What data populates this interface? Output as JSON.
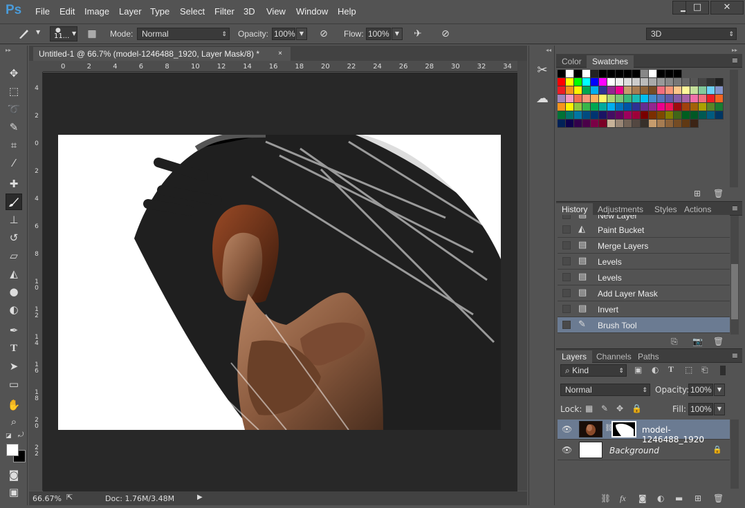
{
  "app": {
    "logo": "Ps",
    "menus": [
      "File",
      "Edit",
      "Image",
      "Layer",
      "Type",
      "Select",
      "Filter",
      "3D",
      "View",
      "Window",
      "Help"
    ],
    "window_buttons": [
      "▁",
      "□",
      "✕"
    ]
  },
  "options": {
    "brush_size": "11...",
    "mode_label": "Mode:",
    "mode_value": "Normal",
    "opacity_label": "Opacity:",
    "opacity_value": "100%",
    "flow_label": "Flow:",
    "flow_value": "100%",
    "workspace": "3D"
  },
  "document": {
    "tab_title": "Untitled-1 @ 66.7% (model-1246488_1920, Layer Mask/8) *",
    "ruler_top": [
      "0",
      "2",
      "4",
      "6",
      "8",
      "10",
      "12",
      "14",
      "16",
      "18",
      "20",
      "22",
      "24",
      "26",
      "28",
      "30",
      "32",
      "34"
    ],
    "ruler_left": [
      "4",
      "2",
      "0",
      "2",
      "4",
      "6",
      "8",
      "1\n0",
      "1\n2",
      "1\n4",
      "1\n6",
      "1\n8",
      "2\n0",
      "2\n2"
    ],
    "zoom": "66.67%",
    "doc_info": "Doc: 1.76M/3.48M"
  },
  "swatches_panel": {
    "tabs": [
      "Color",
      "Swatches"
    ],
    "active_tab": "Swatches",
    "rows": [
      [
        "#000000",
        "#ffffff",
        "#000000",
        "#ffffff",
        "#222222",
        "#000000",
        "#000000",
        "#000000",
        "#000000",
        "#000000",
        "#888888",
        "#ffffff",
        "#000000",
        "#000000",
        "#000000"
      ],
      [
        "#ff0000",
        "#ffff00",
        "#00ff00",
        "#00ffff",
        "#0000ff",
        "#ff00ff",
        "#ffffff",
        "#eeeeee",
        "#dddddd",
        "#cccccc",
        "#bbbbbb",
        "#aaaaaa",
        "#999999",
        "#888888",
        "#777777",
        "#666666",
        "#555555",
        "#444444",
        "#333333",
        "#222222"
      ],
      [
        "#ed1c24",
        "#f7941d",
        "#fff200",
        "#00a651",
        "#00aeef",
        "#2e3192",
        "#92278f",
        "#ec008c",
        "#c69c6d",
        "#a67c52",
        "#8c6239",
        "#754c24",
        "#f26d7d",
        "#f69679",
        "#fdc689",
        "#fff799",
        "#c4df9b",
        "#82ca9c",
        "#6dcff6",
        "#8393ca"
      ],
      [
        "#a186be",
        "#f49ac2",
        "#f26c4f",
        "#f7977a",
        "#fbaf5d",
        "#fff568",
        "#acd373",
        "#7cc576",
        "#3bb878",
        "#1abbb4",
        "#00bff3",
        "#448ccb",
        "#5674b9",
        "#605ca8",
        "#855fa8",
        "#a763a8",
        "#f06ea9",
        "#f26d7d",
        "#ed1c24",
        "#f26522"
      ],
      [
        "#f7941d",
        "#fff200",
        "#8dc63f",
        "#39b54a",
        "#00a651",
        "#00a99d",
        "#00aeef",
        "#0072bc",
        "#0054a6",
        "#2e3192",
        "#662d91",
        "#92278f",
        "#ec008c",
        "#ed145b",
        "#9e0b0f",
        "#a0410d",
        "#a36209",
        "#aba000",
        "#598527",
        "#1a7b30"
      ],
      [
        "#007236",
        "#00746b",
        "#0076a3",
        "#004b80",
        "#003471",
        "#1b1464",
        "#440e62",
        "#630460",
        "#9e005d",
        "#9e0039",
        "#790000",
        "#7b2e00",
        "#7d4900",
        "#827b00",
        "#406618",
        "#005e20",
        "#005826",
        "#005952",
        "#005b7f",
        "#003663"
      ],
      [
        "#002157",
        "#0d004c",
        "#32004b",
        "#4b0049",
        "#7b0046",
        "#7a0026",
        "#c7b299",
        "#998675",
        "#736357",
        "#534741",
        "#37302a",
        "#c69c6d",
        "#a67c52",
        "#8c6239",
        "#754c24",
        "#603913",
        "#3c2415"
      ]
    ]
  },
  "history_panel": {
    "tabs": [
      "History",
      "Adjustments",
      "Styles",
      "Actions"
    ],
    "active_tab": "History",
    "items": [
      {
        "label": "New Layer",
        "icon": "document-icon"
      },
      {
        "label": "Paint Bucket",
        "icon": "paint-bucket-icon"
      },
      {
        "label": "Merge Layers",
        "icon": "document-icon"
      },
      {
        "label": "Levels",
        "icon": "document-icon"
      },
      {
        "label": "Levels",
        "icon": "document-icon"
      },
      {
        "label": "Add Layer Mask",
        "icon": "document-icon"
      },
      {
        "label": "Invert",
        "icon": "document-icon"
      },
      {
        "label": "Brush Tool",
        "icon": "brush-icon",
        "selected": true
      }
    ]
  },
  "layers_panel": {
    "tabs": [
      "Layers",
      "Channels",
      "Paths"
    ],
    "active_tab": "Layers",
    "filter_value": "Kind",
    "blend_mode": "Normal",
    "opacity_label": "Opacity:",
    "opacity_value": "100%",
    "lock_label": "Lock:",
    "fill_label": "Fill:",
    "fill_value": "100%",
    "layers": [
      {
        "name": "model-1246488_1920",
        "selected": true,
        "has_mask": true
      },
      {
        "name": "Background",
        "selected": false,
        "locked": true
      }
    ]
  },
  "colors": {
    "accent_selected": "#6b7b92",
    "panel_bg": "#535353",
    "canvas_bg": "#282828",
    "logo": "#4a9bd9"
  }
}
